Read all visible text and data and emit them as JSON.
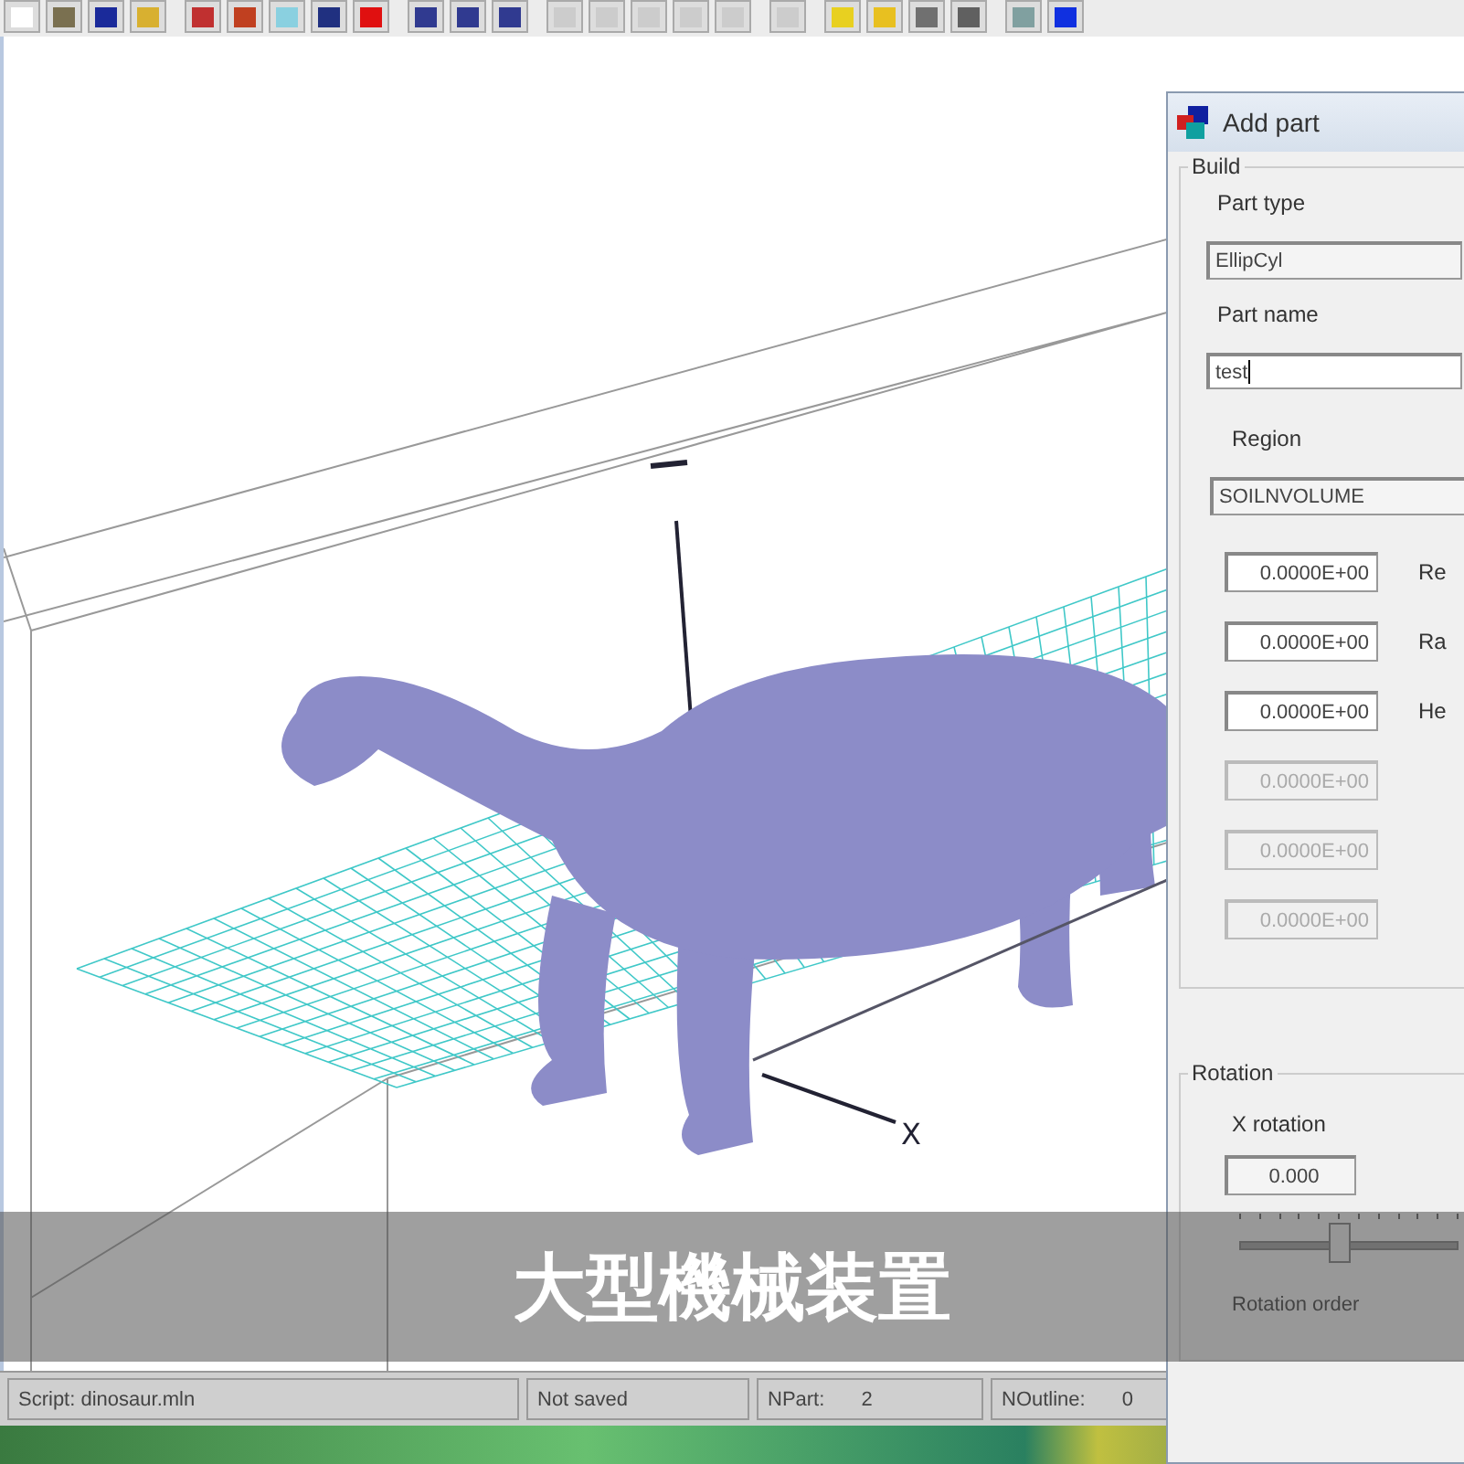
{
  "viewport": {
    "x_axis_label": "X"
  },
  "dialog": {
    "title": "Add part",
    "build": {
      "legend": "Build",
      "part_type_label": "Part type",
      "part_type": "EllipCyl",
      "part_name_label": "Part name",
      "part_name": "test",
      "region_label": "Region",
      "region": "SOILNVOLUME",
      "params": [
        {
          "value": "0.0000E+00",
          "label": "Re",
          "disabled": false
        },
        {
          "value": "0.0000E+00",
          "label": "Ra",
          "disabled": false
        },
        {
          "value": "0.0000E+00",
          "label": "He",
          "disabled": false
        },
        {
          "value": "0.0000E+00",
          "disabled": true
        },
        {
          "value": "0.0000E+00",
          "disabled": true
        },
        {
          "value": "0.0000E+00",
          "disabled": true
        }
      ]
    },
    "rotation": {
      "legend": "Rotation",
      "x_label": "X rotation",
      "x_value": "0.000",
      "slider": {
        "level": 0.45
      },
      "order_label": "Rotation order"
    }
  },
  "status_bar": [
    {
      "text": "Script: dinosaur.mln"
    },
    {
      "text": "Not saved"
    },
    {
      "label": "NPart:",
      "value": "2"
    },
    {
      "label": "NOutline:",
      "value": "0"
    }
  ],
  "caption": "大型機械装置"
}
